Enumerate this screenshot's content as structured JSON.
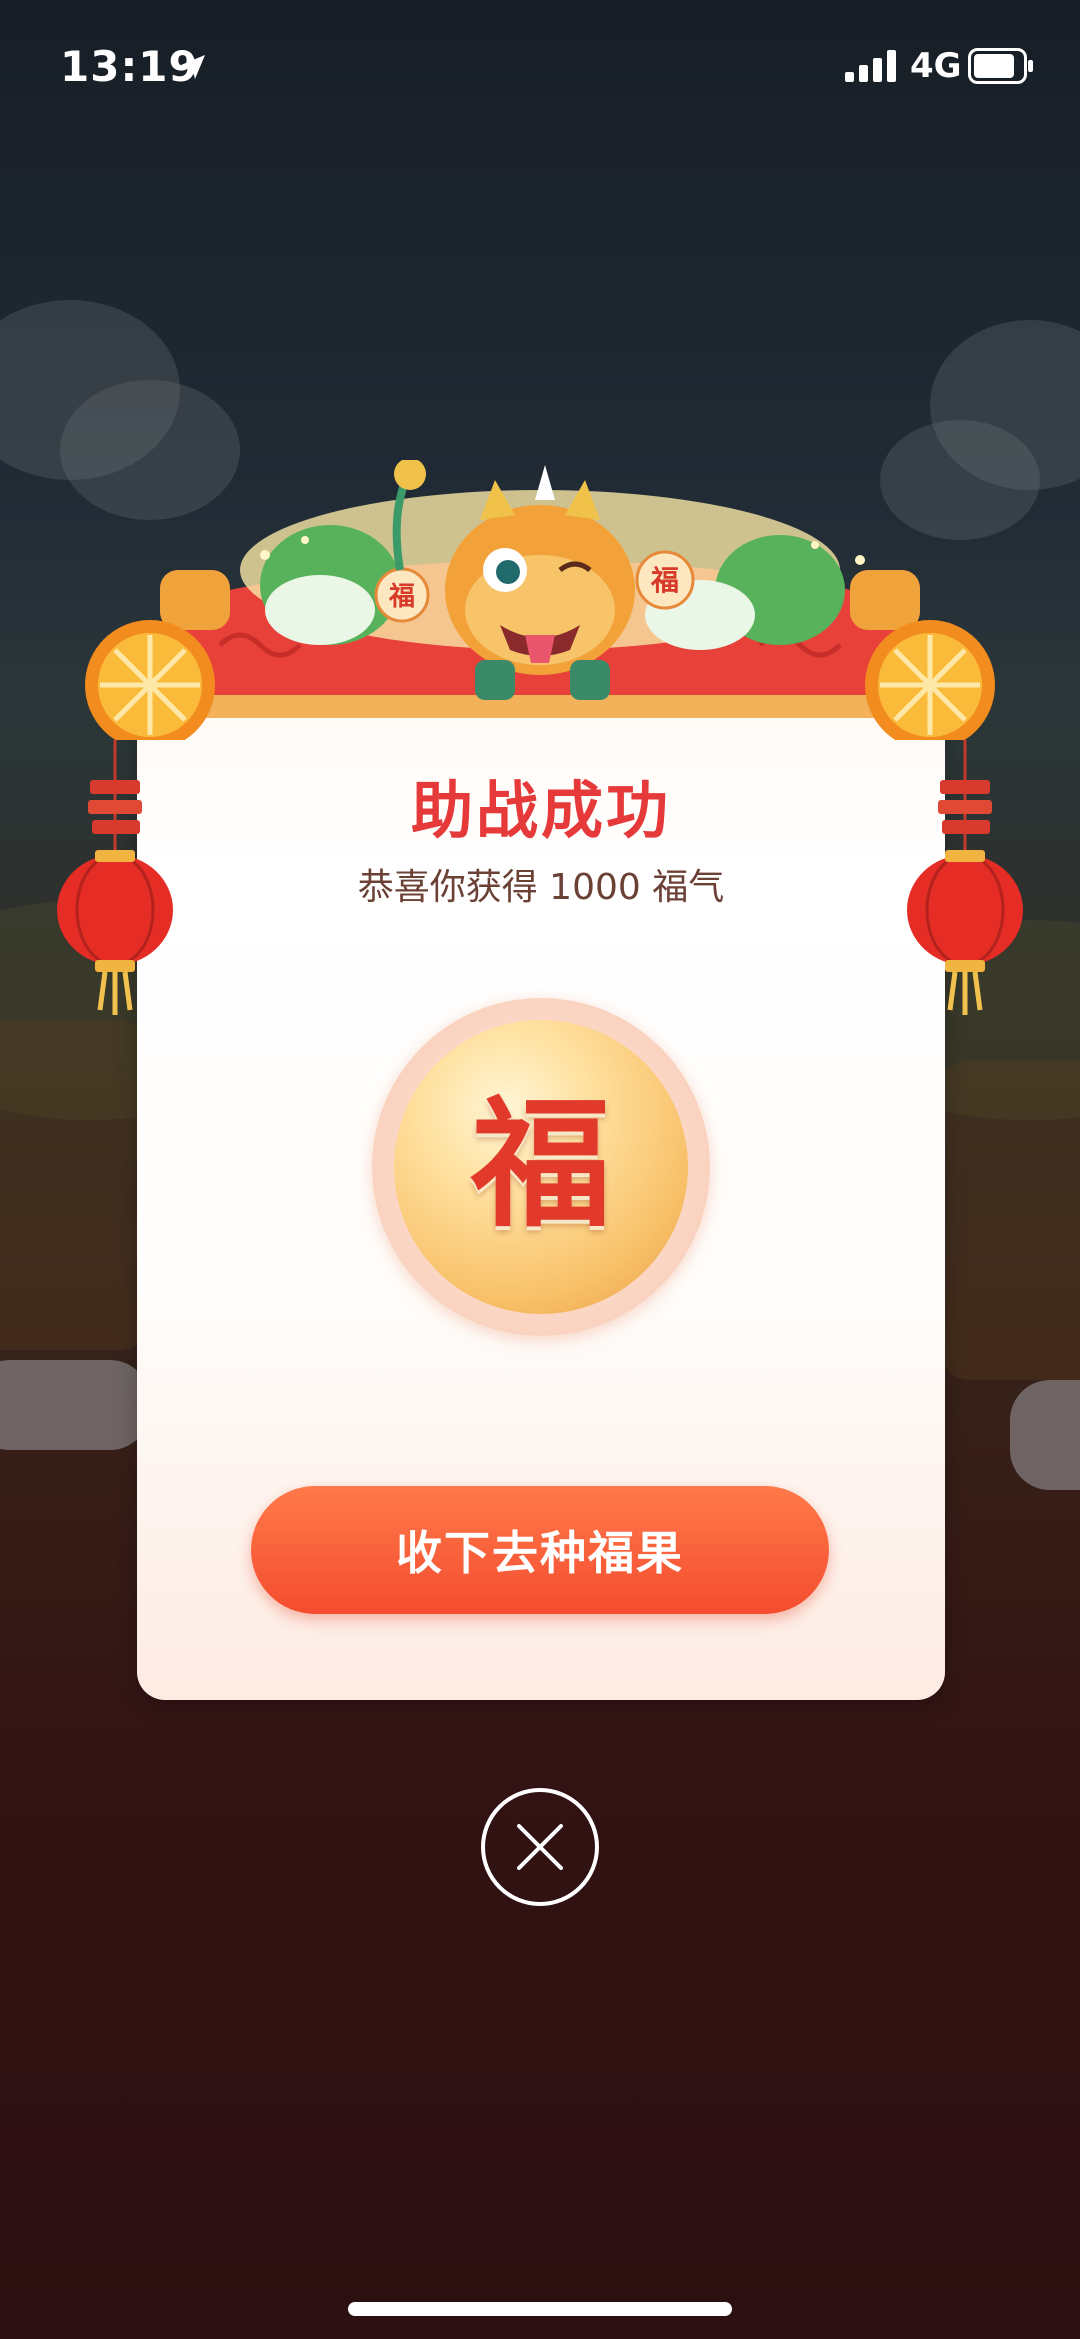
{
  "status_bar": {
    "time": "13:19",
    "network": "4G",
    "icons": [
      "location-arrow-icon",
      "signal-icon",
      "battery-icon"
    ]
  },
  "dialog": {
    "title": "助战成功",
    "subtitle": "恭喜你获得 1000 福气",
    "coin_glyph": "福",
    "header_badge_left": "福",
    "header_badge_right": "福",
    "primary_button_label": "收下去种福果"
  },
  "colors": {
    "title": "#e63a3a",
    "button": "#f44c2e",
    "subtitle": "#6b4136"
  },
  "close_icon": "close-icon"
}
